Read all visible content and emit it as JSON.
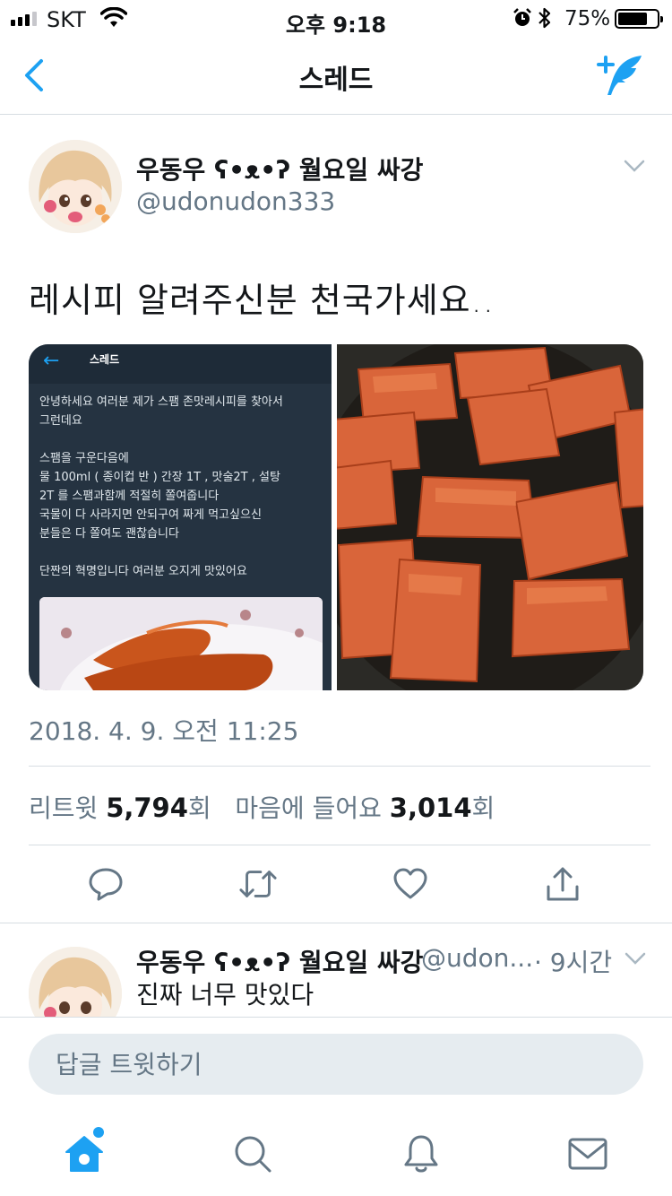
{
  "status_bar": {
    "carrier": "SKT",
    "time": "오후 9:18",
    "battery_percent": "75%",
    "battery_level": 0.75
  },
  "nav": {
    "title": "스레드",
    "back_icon": "chevron-left-icon",
    "compose_icon": "compose-tweet-icon"
  },
  "tweet": {
    "name": "우동우 ʕ•ᴥ•ʔ 월요일 싸강",
    "handle": "@udonudon333",
    "text": "레시피 알려주신분 천국가세요..",
    "media_left": {
      "title": "스레드",
      "lines": [
        "안녕하세요 여러분 제가 스팸 존맛레시피를 찾아서",
        "그런데요",
        "",
        "스팸을 구운다음에",
        "물 100ml ( 종이컵 반 ) 간장 1T , 맛술2T , 설탕",
        "2T 를 스팸과함께 적절히 쫄여줍니다",
        "국물이 다 사라지면 안되구여 짜게 먹고싶으신",
        "분들은 다 쫄여도 괜찮습니다",
        "",
        "단짠의 혁명입니다 여러분 오지게 맛있어요"
      ]
    },
    "timestamp": "2018. 4. 9. 오전 11:25",
    "retweet_label": "리트윗",
    "retweet_count": "5,794",
    "likes_label": "마음에 들어요",
    "likes_count": "3,014",
    "count_suffix": "회"
  },
  "reply": {
    "name": "우동우 ʕ•ᴥ•ʔ 월요일 싸강",
    "handle": "@udon...",
    "time": "· 9시간",
    "text": "진짜 너무 맛있다"
  },
  "composer": {
    "placeholder": "답글 트윗하기"
  },
  "colors": {
    "accent": "#1da1f2",
    "secondary_text": "#657786",
    "divider": "#d7dde2"
  }
}
